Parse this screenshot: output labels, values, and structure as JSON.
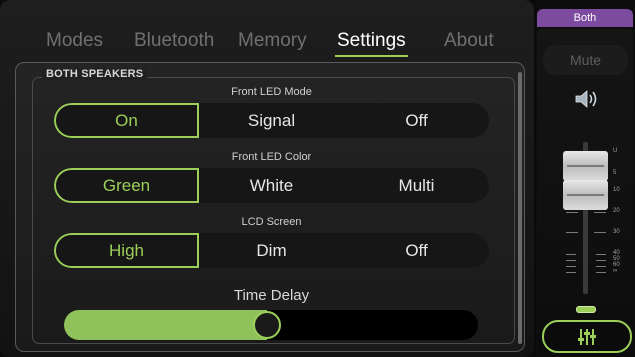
{
  "tabs": [
    {
      "label": "Modes"
    },
    {
      "label": "Bluetooth"
    },
    {
      "label": "Memory"
    },
    {
      "label": "Settings",
      "active": true
    },
    {
      "label": "About"
    }
  ],
  "group_label": "BOTH SPEAKERS",
  "front_led_mode": {
    "label": "Front LED Mode",
    "options": [
      "On",
      "Signal",
      "Off"
    ],
    "selected": "On"
  },
  "front_led_color": {
    "label": "Front LED Color",
    "options": [
      "Green",
      "White",
      "Multi"
    ],
    "selected": "Green"
  },
  "lcd_screen": {
    "label": "LCD Screen",
    "options": [
      "High",
      "Dim",
      "Off"
    ],
    "selected": "High"
  },
  "time_delay": {
    "label": "Time Delay",
    "value_fraction": 0.49
  },
  "strip": {
    "target_label": "Both",
    "mute_label": "Mute",
    "fader_scale": [
      "U",
      "5",
      "10",
      "20",
      "30",
      "40",
      "50",
      "60",
      "∞"
    ]
  },
  "colors": {
    "accent": "#9ccf5a",
    "target_tab": "#7c4a9e"
  }
}
